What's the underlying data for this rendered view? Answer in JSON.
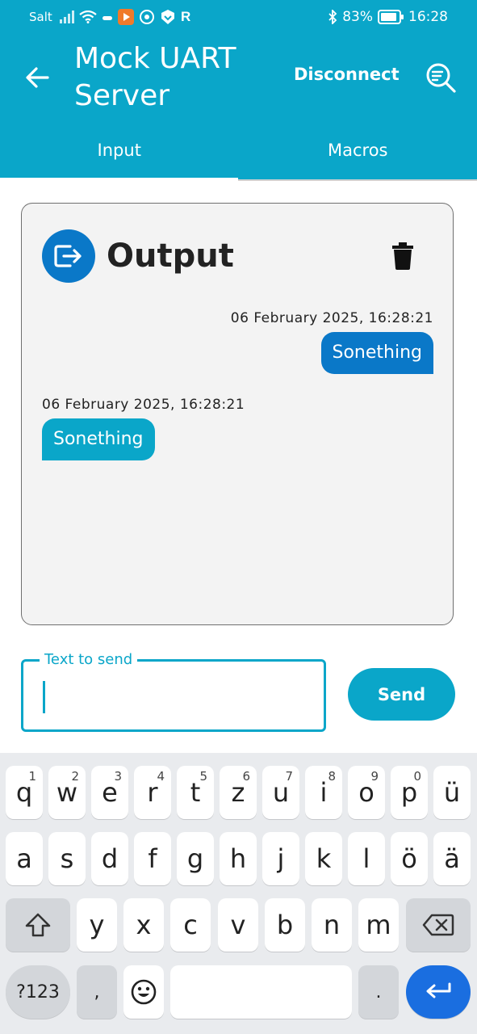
{
  "status_bar": {
    "carrier": "Salt",
    "battery": "83%",
    "time": "16:28"
  },
  "app_bar": {
    "title": "Mock UART Server",
    "disconnect_label": "Disconnect",
    "tabs": [
      {
        "label": "Input",
        "active": true
      },
      {
        "label": "Macros",
        "active": false
      }
    ]
  },
  "output": {
    "title": "Output",
    "messages": [
      {
        "direction": "sent",
        "timestamp": "06 February 2025, 16:28:21",
        "text": "Sonething"
      },
      {
        "direction": "received",
        "timestamp": "06 February 2025, 16:28:21",
        "text": "Sonething"
      }
    ]
  },
  "input": {
    "label": "Text to send",
    "value": "",
    "send_label": "Send"
  },
  "keyboard": {
    "row1": [
      {
        "key": "q",
        "hint": "1"
      },
      {
        "key": "w",
        "hint": "2"
      },
      {
        "key": "e",
        "hint": "3"
      },
      {
        "key": "r",
        "hint": "4"
      },
      {
        "key": "t",
        "hint": "5"
      },
      {
        "key": "z",
        "hint": "6"
      },
      {
        "key": "u",
        "hint": "7"
      },
      {
        "key": "i",
        "hint": "8"
      },
      {
        "key": "o",
        "hint": "9"
      },
      {
        "key": "p",
        "hint": "0"
      },
      {
        "key": "ü",
        "hint": ""
      }
    ],
    "row2": [
      "a",
      "s",
      "d",
      "f",
      "g",
      "h",
      "j",
      "k",
      "l",
      "ö",
      "ä"
    ],
    "row3": [
      "y",
      "x",
      "c",
      "v",
      "b",
      "n",
      "m"
    ],
    "symbols_label": "?123",
    "comma": ",",
    "period": "."
  },
  "colors": {
    "primary": "#0aa6c9",
    "sent_bubble": "#0a78c8",
    "enter_key": "#1a6ee0"
  }
}
